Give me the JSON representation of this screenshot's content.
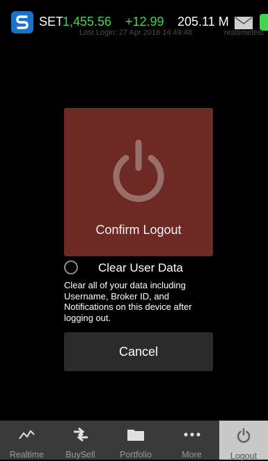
{
  "header": {
    "market_name": "SET",
    "index_value": "1,455.56",
    "index_change": "+12.99",
    "volume": "205.11 M",
    "last_login": "Last Login: 27 Apr 2016 14:49:48",
    "user_id": "realtimetest",
    "mail_icon": "mail-icon",
    "accent_color": "#3fd64a"
  },
  "logout": {
    "confirm_label": "Confirm Logout",
    "panel_color": "#6d2a24",
    "clear_data_label": "Clear User Data",
    "clear_data_description": "Clear all of your data including Username, Broker ID, and Notifications on this device after logging out.",
    "cancel_label": "Cancel"
  },
  "tabs": [
    {
      "label": "Realtime",
      "icon": "line-chart-icon"
    },
    {
      "label": "BuySell",
      "icon": "swap-arrows-icon"
    },
    {
      "label": "Portfolio",
      "icon": "folder-icon"
    },
    {
      "label": "More",
      "icon": "more-dots-icon"
    },
    {
      "label": "Logout",
      "icon": "power-icon",
      "active": true
    }
  ]
}
